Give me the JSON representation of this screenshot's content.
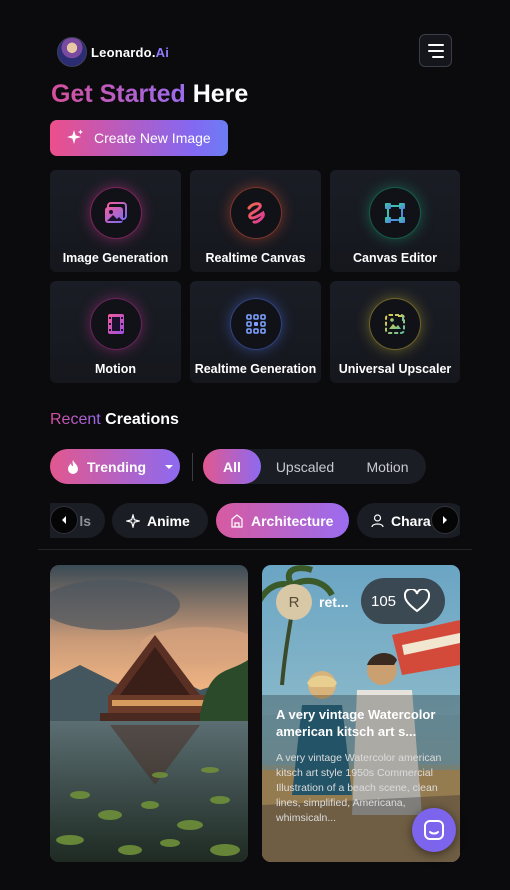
{
  "header": {
    "logo_text_main": "Leonardo.",
    "logo_text_accent": "Ai",
    "avatar_icon": "leonardo-avatar-logo",
    "menu_icon": "hamburger-menu-icon"
  },
  "hero": {
    "title_accent": "Get Started",
    "title_plain": "Here",
    "cta_label": "Create New Image",
    "cta_icon": "sparkle-icon"
  },
  "tools": [
    {
      "label": "Image Generation",
      "icon": "image-gallery-icon",
      "color": "#e0389b"
    },
    {
      "label": "Realtime Canvas",
      "icon": "brush-stroke-icon",
      "color": "#e6573a"
    },
    {
      "label": "Canvas Editor",
      "icon": "crop-frame-icon",
      "color": "#1ea37a"
    },
    {
      "label": "Motion",
      "icon": "film-strip-icon",
      "color": "#c23695"
    },
    {
      "label": "Realtime Generation",
      "icon": "grid-dots-icon",
      "color": "#4f74e8"
    },
    {
      "label": "Universal Upscaler",
      "icon": "upscale-image-icon",
      "color": "#c9b43a"
    }
  ],
  "recent": {
    "title_accent": "Recent",
    "title_plain": "Creations"
  },
  "filters": {
    "sort_label": "Trending",
    "sort_icon": "flame-icon",
    "segments": [
      "All",
      "Upscaled",
      "Motion"
    ],
    "active_segment": "All"
  },
  "categories": [
    {
      "label": "ls",
      "icon": ""
    },
    {
      "label": "Anime",
      "icon": "star-sparkle-icon"
    },
    {
      "label": "Architecture",
      "icon": "building-icon"
    },
    {
      "label": "Chara",
      "icon": "person-icon"
    }
  ],
  "active_category": "Architecture",
  "cards": [
    {
      "image": "tropical-lake-house-photo"
    },
    {
      "user_initial": "R",
      "username": "ret...",
      "likes": "105",
      "title": "A very vintage Watercolor american kitsch art s...",
      "description": "A very vintage Watercolor american kitsch art style 1950s Commercial Illustration of a beach scene, clean lines, simplified, Americana, whimsicaln..."
    }
  ],
  "chat_icon": "chat-support-icon"
}
